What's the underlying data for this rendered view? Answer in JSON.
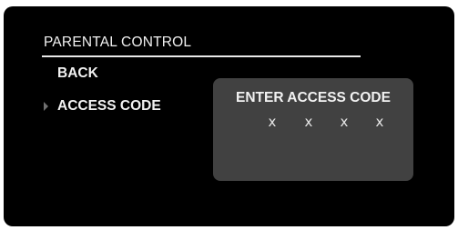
{
  "menu": {
    "title": "PARENTAL CONTROL",
    "items": [
      {
        "label": "BACK"
      },
      {
        "label": "ACCESS CODE",
        "selected": true
      }
    ]
  },
  "dialog": {
    "title": "ENTER ACCESS CODE",
    "code_slots": [
      "x",
      "x",
      "x",
      "x"
    ]
  },
  "colors": {
    "background": "#000000",
    "text": "#f2f2f2",
    "dialog": "#414141",
    "pointer": "#707070"
  },
  "icons": {
    "selection_pointer": "triangle-right-icon"
  }
}
